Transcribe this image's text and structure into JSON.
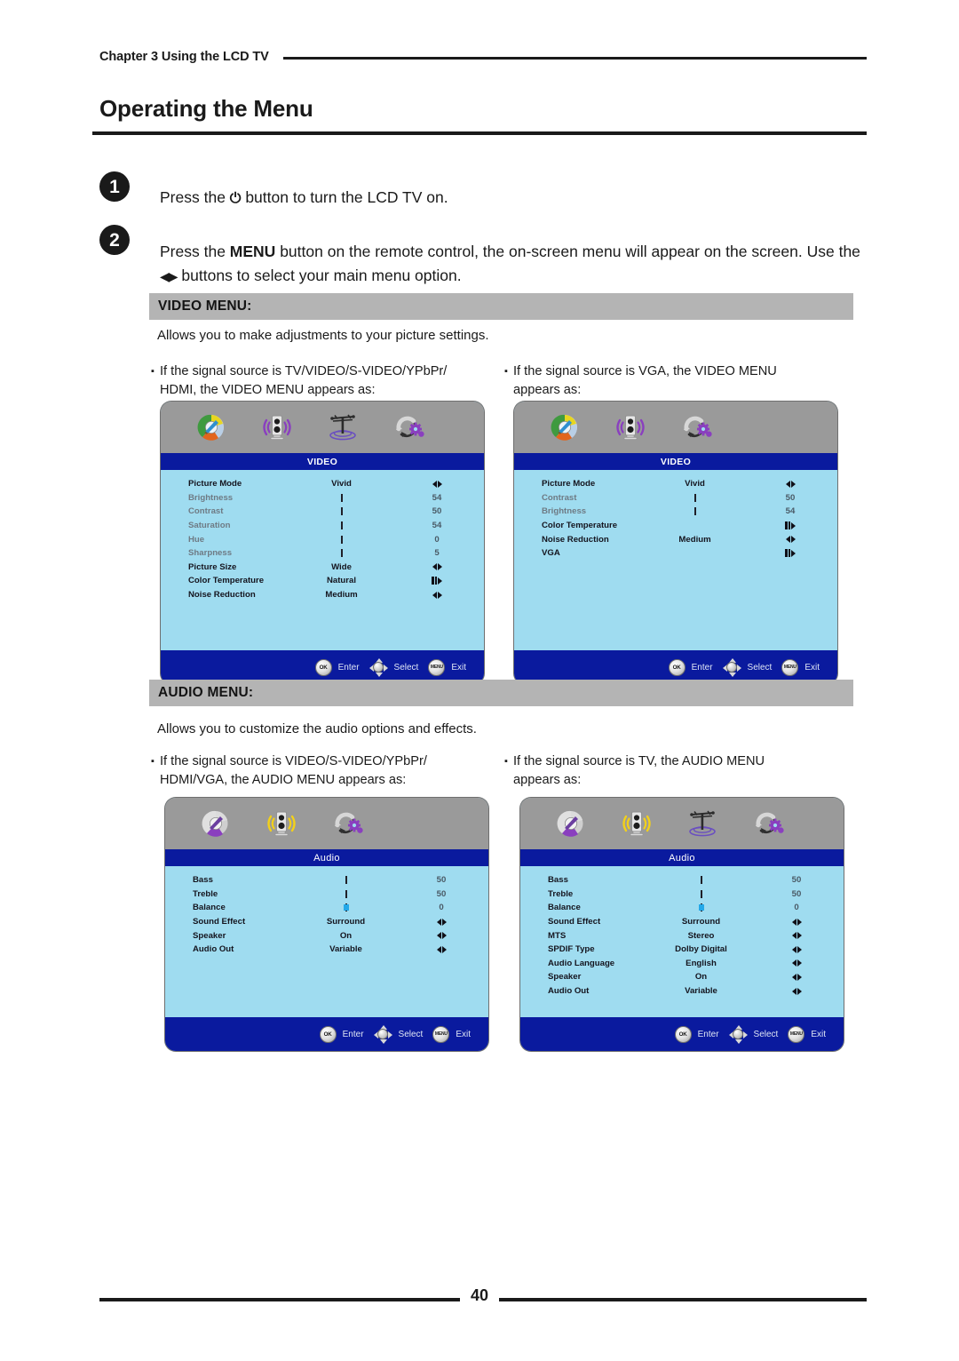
{
  "header": {
    "chapter": "Chapter 3 Using the LCD TV",
    "title": "Operating the Menu"
  },
  "steps": [
    {
      "number": "❶",
      "badge": "1",
      "text_before": "Press the ",
      "power_glyph": "⏻",
      "text_after": " button to turn the LCD TV on."
    },
    {
      "badge": "2",
      "line1_a": "Press the ",
      "line1_menu": "MENU",
      "line1_b": " button on the remote control, the on-screen menu will appear on the",
      "line2_a": "screen. Use the ",
      "line2_glyph": "◀▶",
      "line2_b": " buttons to select your main menu option."
    }
  ],
  "sections": [
    {
      "id": "video",
      "header": "VIDEO MENU:",
      "description": "Allows you to make adjustments to your picture settings.",
      "bullets": [
        "If the signal source is TV/VIDEO/S-VIDEO/YPbPr/\nHDMI, the VIDEO MENU appears as:",
        "If the signal source is VGA, the VIDEO MENU\nappears as:"
      ]
    },
    {
      "id": "audio",
      "header": "AUDIO MENU:",
      "description": "Allows you to customize the audio options and effects.",
      "bullets": [
        "If the signal source is VIDEO/S-VIDEO/YPbPr/\nHDMI/VGA, the AUDIO MENU appears as:",
        "If the signal source is TV, the AUDIO MENU\nappears as:"
      ]
    }
  ],
  "osd_footer": {
    "ok_label": "OK",
    "enter_label": "Enter",
    "select_label": "Select",
    "menu_label": "MENU",
    "exit_label": "Exit"
  },
  "osd_panels": [
    {
      "id": "video-menu-tv",
      "title": "VIDEO",
      "title_style": "caps",
      "slider_fill": "#2d2d8c",
      "icons": [
        "video-wheel-icon",
        "speaker-icon",
        "antenna-icon",
        "setup-gear-icon"
      ],
      "active_icon": 0,
      "rows": [
        {
          "label": "Picture Mode",
          "type": "option",
          "value": "Vivid",
          "dim": false,
          "arrows": "lr"
        },
        {
          "label": "Brightness",
          "type": "slider",
          "value": "54",
          "pct": 80,
          "dim": true
        },
        {
          "label": "Contrast",
          "type": "slider",
          "value": "50",
          "pct": 76,
          "dim": true
        },
        {
          "label": "Saturation",
          "type": "slider",
          "value": "54",
          "pct": 80,
          "dim": true
        },
        {
          "label": "Hue",
          "type": "slider",
          "value": "0",
          "pct": 53,
          "dim": true
        },
        {
          "label": "Sharpness",
          "type": "slider",
          "value": "5",
          "pct": 58,
          "dim": true
        },
        {
          "label": "Picture Size",
          "type": "option",
          "value": "Wide",
          "dim": false,
          "arrows": "lr"
        },
        {
          "label": "Color Temperature",
          "type": "option",
          "value": "Natural",
          "dim": false,
          "arrows": "sub"
        },
        {
          "label": "Noise Reduction",
          "type": "option",
          "value": "Medium",
          "dim": false,
          "arrows": "lr"
        }
      ]
    },
    {
      "id": "video-menu-vga",
      "title": "VIDEO",
      "title_style": "caps",
      "slider_fill": "#23a8e8",
      "icons": [
        "video-wheel-icon",
        "speaker-icon",
        "setup-gear-icon"
      ],
      "active_icon": 0,
      "rows": [
        {
          "label": "Picture Mode",
          "type": "option",
          "value": "Vivid",
          "dim": false,
          "arrows": "lr"
        },
        {
          "label": "Contrast",
          "type": "slider",
          "value": "50",
          "pct": 76,
          "dim": true
        },
        {
          "label": "Brightness",
          "type": "slider",
          "value": "54",
          "pct": 80,
          "dim": true
        },
        {
          "label": "Color Temperature",
          "type": "option",
          "value": "",
          "dim": false,
          "arrows": "sub"
        },
        {
          "label": "Noise Reduction",
          "type": "option",
          "value": "Medium",
          "dim": false,
          "arrows": "lr"
        },
        {
          "label": "VGA",
          "type": "option",
          "value": "",
          "dim": false,
          "arrows": "sub"
        }
      ]
    },
    {
      "id": "audio-menu-generic",
      "title": "Audio",
      "title_style": "mixed",
      "slider_fill": "#23a8e8",
      "icons": [
        "video-wheel-icon",
        "speaker-icon",
        "setup-gear-icon"
      ],
      "active_icon": 1,
      "rows": [
        {
          "label": "Bass",
          "type": "slider",
          "value": "50",
          "pct": 76,
          "dim": false
        },
        {
          "label": "Treble",
          "type": "slider",
          "value": "50",
          "pct": 76,
          "dim": false
        },
        {
          "label": "Balance",
          "type": "balance",
          "value": "0",
          "pct": 50,
          "dim": false
        },
        {
          "label": "Sound Effect",
          "type": "option",
          "value": "Surround",
          "dim": false,
          "arrows": "lr"
        },
        {
          "label": "Speaker",
          "type": "option",
          "value": "On",
          "dim": false,
          "arrows": "lr"
        },
        {
          "label": "Audio Out",
          "type": "option",
          "value": "Variable",
          "dim": false,
          "arrows": "lr"
        }
      ]
    },
    {
      "id": "audio-menu-tv",
      "title": "Audio",
      "title_style": "mixed",
      "slider_fill": "#23a8e8",
      "icons": [
        "video-wheel-icon",
        "speaker-icon",
        "antenna-icon",
        "setup-gear-icon"
      ],
      "active_icon": 1,
      "rows": [
        {
          "label": "Bass",
          "type": "slider",
          "value": "50",
          "pct": 76,
          "dim": false
        },
        {
          "label": "Treble",
          "type": "slider",
          "value": "50",
          "pct": 76,
          "dim": false
        },
        {
          "label": "Balance",
          "type": "balance",
          "value": "0",
          "pct": 50,
          "dim": false
        },
        {
          "label": "Sound Effect",
          "type": "option",
          "value": "Surround",
          "dim": false,
          "arrows": "lr"
        },
        {
          "label": "MTS",
          "type": "option",
          "value": "Stereo",
          "dim": false,
          "arrows": "lr"
        },
        {
          "label": "SPDIF Type",
          "type": "option",
          "value": "Dolby Digital",
          "dim": false,
          "arrows": "lr"
        },
        {
          "label": "Audio Language",
          "type": "option",
          "value": "English",
          "dim": false,
          "arrows": "lr"
        },
        {
          "label": "Speaker",
          "type": "option",
          "value": "On",
          "dim": false,
          "arrows": "lr"
        },
        {
          "label": "Audio Out",
          "type": "option",
          "value": "Variable",
          "dim": false,
          "arrows": "lr"
        }
      ]
    }
  ],
  "footer": {
    "page_number": "40"
  },
  "colors": {
    "osd_body": "#9fdcf0",
    "osd_title_bar": "#0a1a9e",
    "osd_icon_bar": "#9a9a9a",
    "section_header": "#b4b4b4",
    "slider_dark": "#2d2d8c",
    "slider_cyan": "#23a8e8"
  }
}
